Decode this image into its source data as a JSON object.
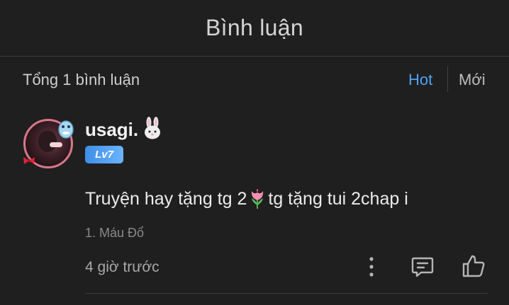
{
  "header": {
    "title": "Bình luận"
  },
  "filter": {
    "total_label": "Tổng 1 bình luận",
    "sort_options": [
      {
        "label": "Hot",
        "active": true
      },
      {
        "label": "Mới",
        "active": false
      }
    ],
    "active_color": "#4fa3f7"
  },
  "comment": {
    "username": "usagi.",
    "username_emoji": "bunny-icon",
    "level": "Lv7",
    "text_before": "Truyện hay tặng tg 2",
    "text_emoji": "tulip-icon",
    "text_after": "tg tặng tui 2chap i",
    "chapter_ref": "1. Máu Đổ",
    "time_ago": "4 giờ trước",
    "actions": [
      "more-icon",
      "reply-icon",
      "like-icon"
    ]
  },
  "colors": {
    "background": "#1f1f1f",
    "level_badge": "#4a9cf0",
    "avatar_ring": "#d8788b"
  }
}
